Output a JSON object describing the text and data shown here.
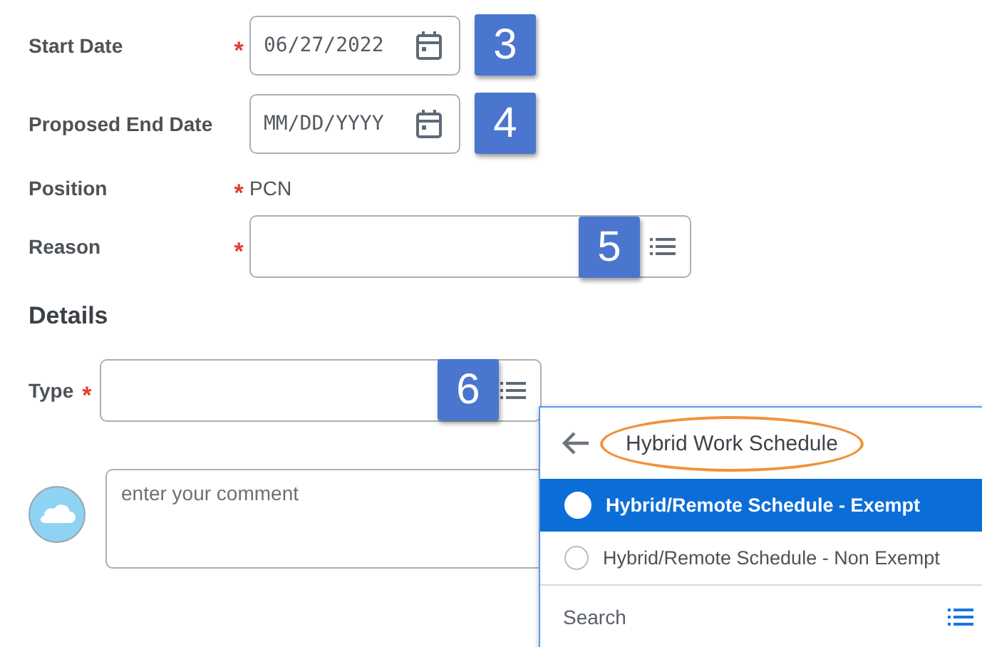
{
  "fields": [
    {
      "kind": "date",
      "label": "Start Date",
      "required_mark": "*",
      "value": "06/27/2022",
      "callout": "3"
    },
    {
      "kind": "date",
      "label": "Proposed End Date",
      "placeholder": "MM/DD/YYYY",
      "callout": "4"
    },
    {
      "kind": "text",
      "label": "Position",
      "required_mark": "*",
      "value": "PCN"
    },
    {
      "kind": "prompt",
      "label": "Reason",
      "required_mark": "*",
      "callout": "5"
    }
  ],
  "details": {
    "heading": "Details",
    "type_field": {
      "label": "Type",
      "required_mark": "*",
      "callout": "6"
    }
  },
  "comment": {
    "placeholder": "enter your comment"
  },
  "popup": {
    "title": "Hybrid Work Schedule",
    "options": [
      {
        "label": "Hybrid/Remote Schedule - Exempt",
        "selected": true
      },
      {
        "label": "Hybrid/Remote Schedule - Non Exempt",
        "selected": false
      }
    ],
    "search": {
      "placeholder": "Search"
    }
  }
}
